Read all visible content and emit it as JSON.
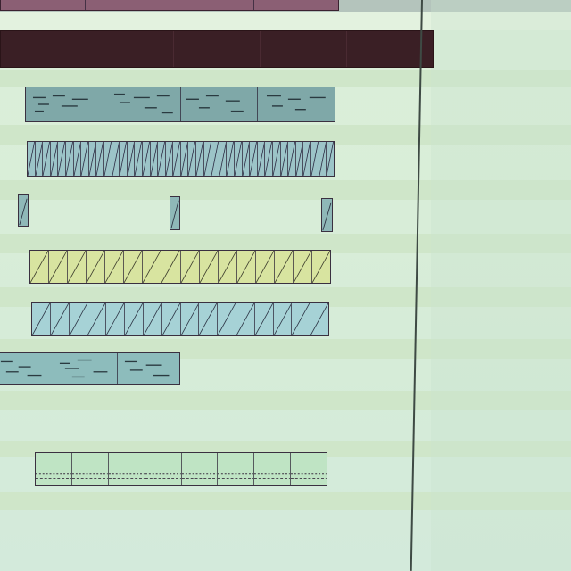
{
  "arrange": {
    "colors": {
      "background": "#dcefd9",
      "lane_dark": "#cfe6c9",
      "lane_light": "#e3f2df",
      "playhead": "#3e4a44",
      "region_dark": "#3a1f25",
      "region_blue": "#7fa8a8",
      "region_yellow": "#d8e4a0",
      "region_cyan": "#a6d2d6",
      "region_green": "#bfe4c4"
    }
  }
}
